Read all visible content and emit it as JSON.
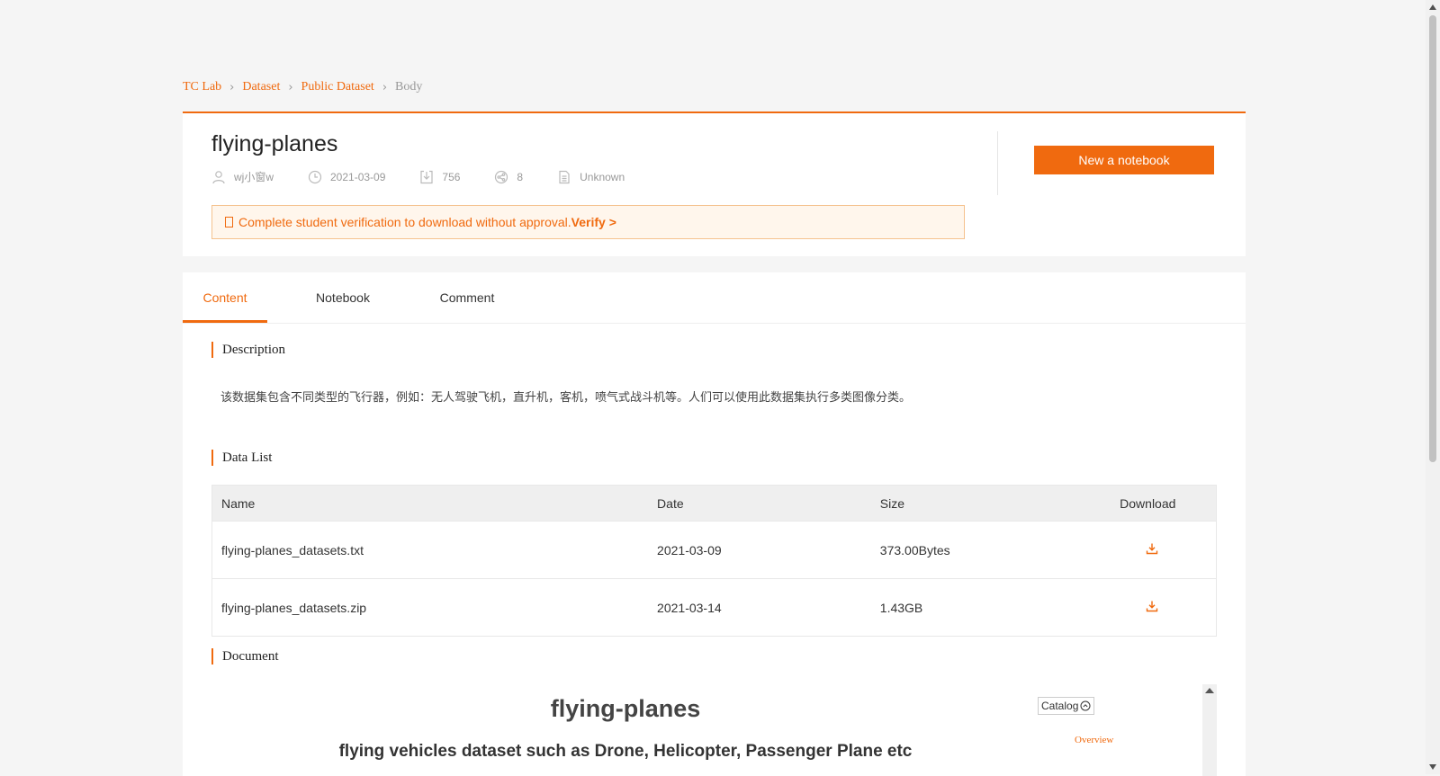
{
  "colors": {
    "accent": "#f06a0f",
    "notice_bg": "#fff6ec",
    "notice_border": "#f5c28e",
    "table_header_bg": "#efefef"
  },
  "breadcrumb": {
    "items": [
      "TC Lab",
      "Dataset",
      "Public Dataset"
    ],
    "current": "Body"
  },
  "dataset": {
    "title": "flying-planes",
    "author": "wj小窗w",
    "date": "2021-03-09",
    "downloads": "756",
    "shares": "8",
    "license": "Unknown"
  },
  "notice": {
    "text": "Complete student verification to download without approval.",
    "link": "Verify >"
  },
  "actions": {
    "new_notebook": "New a notebook"
  },
  "tabs": [
    {
      "label": "Content",
      "active": true
    },
    {
      "label": "Notebook",
      "active": false
    },
    {
      "label": "Comment",
      "active": false
    }
  ],
  "sections": {
    "description_title": "Description",
    "description_text": "该数据集包含不同类型的飞行器，例如：无人驾驶飞机，直升机，客机，喷气式战斗机等。人们可以使用此数据集执行多类图像分类。",
    "data_list_title": "Data List",
    "document_title": "Document"
  },
  "table": {
    "headers": [
      "Name",
      "Date",
      "Size",
      "Download"
    ],
    "rows": [
      {
        "name": "flying-planes_datasets.txt",
        "date": "2021-03-09",
        "size": "373.00Bytes",
        "download_icon": "download-icon"
      },
      {
        "name": "flying-planes_datasets.zip",
        "date": "2021-03-14",
        "size": "1.43GB",
        "download_icon": "download-icon"
      }
    ]
  },
  "document": {
    "heading": "flying-planes",
    "subheading": "flying vehicles dataset such as Drone, Helicopter, Passenger Plane etc",
    "catalog_label": "Catalog",
    "catalog_items": [
      "Overview"
    ]
  },
  "icons": {
    "author": "user-icon",
    "date": "clock-icon",
    "downloads": "download-tray-icon",
    "shares": "share-icon",
    "license": "document-icon",
    "catalog_toggle": "chevron-up-circle-icon"
  }
}
